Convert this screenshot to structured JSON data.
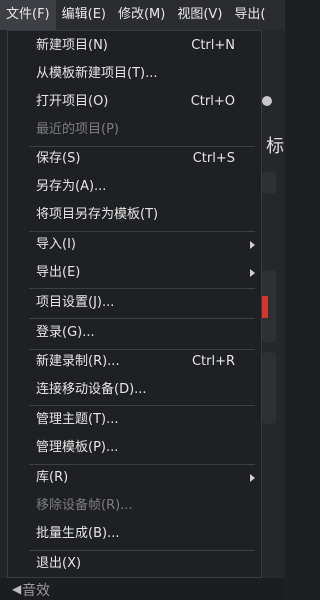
{
  "menubar": {
    "items": [
      "文件(F)",
      "编辑(E)",
      "修改(M)",
      "视图(V)",
      "导出("
    ]
  },
  "background": {
    "title_fragment": "标",
    "bottom_text": "音效"
  },
  "file_menu": {
    "new_project": "新建项目(N)",
    "new_project_shortcut": "Ctrl+N",
    "new_from_template": "从模板新建项目(T)...",
    "open_project": "打开项目(O)",
    "open_project_shortcut": "Ctrl+O",
    "recent_projects": "最近的项目(P)",
    "save": "保存(S)",
    "save_shortcut": "Ctrl+S",
    "save_as": "另存为(A)...",
    "save_as_template": "将项目另存为模板(T)",
    "import": "导入(I)",
    "export": "导出(E)",
    "project_settings": "项目设置(J)...",
    "sign_in": "登录(G)...",
    "new_recording": "新建录制(R)...",
    "new_recording_shortcut": "Ctrl+R",
    "connect_mobile": "连接移动设备(D)...",
    "manage_themes": "管理主题(T)...",
    "manage_templates": "管理模板(P)...",
    "library": "库(R)",
    "remove_device_frame": "移除设备帧(R)...",
    "batch_produce": "批量生成(B)...",
    "exit": "退出(X)"
  },
  "colors": {
    "menu_bg": "#1f2023",
    "menubar_bg": "#2b2c30",
    "active_menu": "#3d3f45",
    "disabled_text": "#7c7d82",
    "accent_red": "#d8342b"
  }
}
